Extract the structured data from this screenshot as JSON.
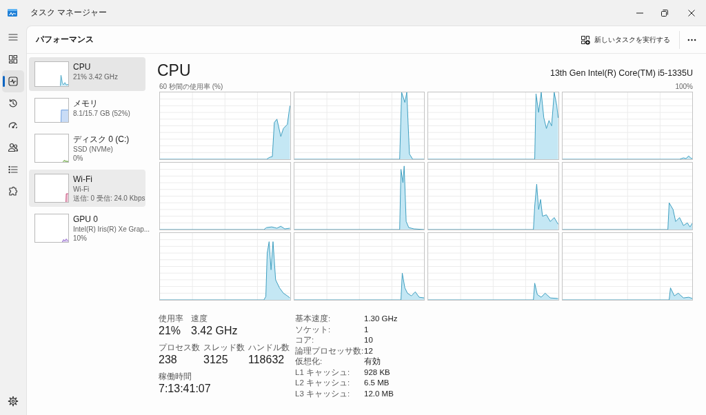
{
  "window": {
    "title": "タスク マネージャー"
  },
  "nav": {
    "items": [
      {
        "kind": "menu",
        "selected": false
      },
      {
        "kind": "processes",
        "selected": false
      },
      {
        "kind": "performance",
        "selected": true
      },
      {
        "kind": "app-history",
        "selected": false
      },
      {
        "kind": "startup",
        "selected": false
      },
      {
        "kind": "users",
        "selected": false
      },
      {
        "kind": "details",
        "selected": false
      },
      {
        "kind": "services",
        "selected": false
      }
    ],
    "footer": [
      {
        "kind": "settings",
        "selected": false
      }
    ]
  },
  "header": {
    "title": "パフォーマンス",
    "run_task": "新しいタスクを実行する"
  },
  "devices": [
    {
      "kind": "cpu",
      "name": "CPU",
      "details": [
        "21% 3.42 GHz"
      ],
      "selected": true,
      "hovered": false
    },
    {
      "kind": "memory",
      "name": "メモリ",
      "details": [
        "8.1/15.7 GB (52%)"
      ],
      "selected": false,
      "hovered": false
    },
    {
      "kind": "disk",
      "name": "ディスク 0 (C:)",
      "details": [
        "SSD (NVMe)",
        "0%"
      ],
      "selected": false,
      "hovered": false
    },
    {
      "kind": "network",
      "name": "Wi-Fi",
      "details": [
        "Wi-Fi",
        "送信: 0 受信: 24.0 Kbps"
      ],
      "selected": false,
      "hovered": true
    },
    {
      "kind": "gpu",
      "name": "GPU 0",
      "details": [
        "Intel(R) Iris(R) Xe Grap...",
        "10%"
      ],
      "selected": false,
      "hovered": false
    }
  ],
  "detail": {
    "title": "CPU",
    "model": "13th Gen Intel(R) Core(TM) i5-1335U",
    "graph_label": "60 秒間の使用率 (%)",
    "graph_max": "100%",
    "stat_rows": [
      [
        {
          "label": "使用率",
          "value": "21%"
        },
        {
          "label": "速度",
          "value": "3.42 GHz"
        }
      ],
      [
        {
          "label": "プロセス数",
          "value": "238"
        },
        {
          "label": "スレッド数",
          "value": "3125"
        },
        {
          "label": "ハンドル数",
          "value": "118632"
        }
      ],
      [
        {
          "label": "稼働時間",
          "value": "7:13:41:07"
        }
      ]
    ],
    "specs": [
      {
        "label": "基本速度:",
        "value": "1.30 GHz"
      },
      {
        "label": "ソケット:",
        "value": "1"
      },
      {
        "label": "コア:",
        "value": "10"
      },
      {
        "label": "論理プロセッサ数:",
        "value": "12"
      },
      {
        "label": "仮想化:",
        "value": "有効"
      },
      {
        "label": "L1 キャッシュ:",
        "value": "928 KB"
      },
      {
        "label": "L2 キャッシュ:",
        "value": "6.5 MB"
      },
      {
        "label": "L3 キャッシュ:",
        "value": "12.0 MB"
      }
    ]
  }
}
